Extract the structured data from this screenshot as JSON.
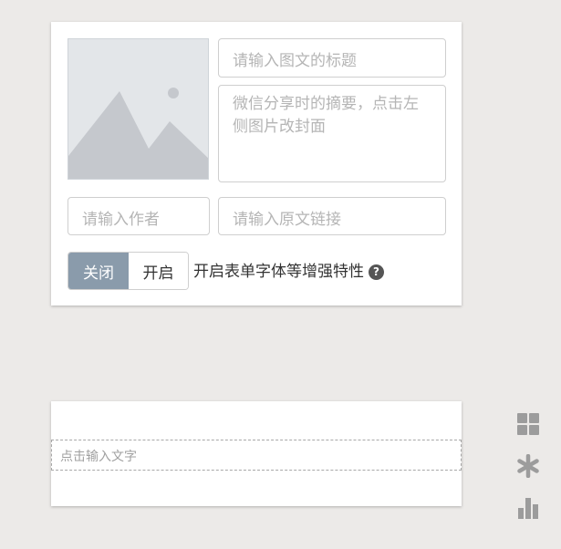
{
  "editor": {
    "title_placeholder": "请输入图文的标题",
    "summary_placeholder": "微信分享时的摘要，点击左侧图片改封面",
    "author_placeholder": "请输入作者",
    "source_url_placeholder": "请输入原文链接",
    "cover_icon": "image-placeholder-icon",
    "font_toggle": {
      "off_label": "关闭",
      "on_label": "开启",
      "selected": "关闭",
      "description": "开启表单字体等增强特性",
      "help_icon": "question-circle-icon",
      "help_symbol": "?"
    }
  },
  "content_block": {
    "text_placeholder": "点击输入文字"
  },
  "side_tools": [
    {
      "icon": "grid-icon"
    },
    {
      "icon": "asterisk-icon"
    },
    {
      "icon": "bar-chart-icon"
    }
  ],
  "colors": {
    "background": "#eceae8",
    "toggle_active": "#8a9bab",
    "icon_gray": "#9c9c9c"
  }
}
